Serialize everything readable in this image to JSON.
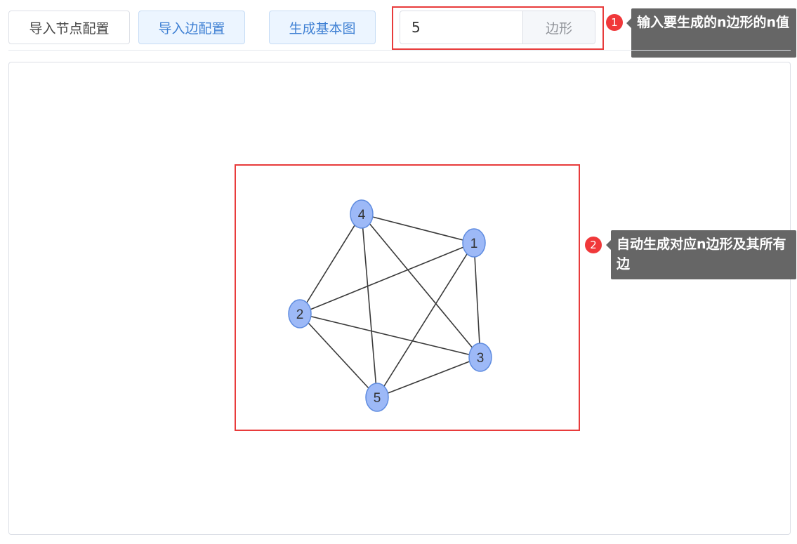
{
  "toolbar": {
    "import_nodes_label": "导入节点配置",
    "import_edges_label": "导入边配置",
    "generate_label": "生成基本图"
  },
  "polygon_input": {
    "value": "5",
    "suffix": "边形"
  },
  "annotations": [
    {
      "badge": "1",
      "text": "输入要生成的n边形的n值"
    },
    {
      "badge": "2",
      "text": "自动生成对应n边形及其所有边"
    }
  ],
  "graph": {
    "node_fill": "#9db9f7",
    "node_stroke": "#5f8ce0",
    "edge_color": "#3a3a3a",
    "nodes": [
      {
        "id": "1",
        "label": "1"
      },
      {
        "id": "2",
        "label": "2"
      },
      {
        "id": "3",
        "label": "3"
      },
      {
        "id": "4",
        "label": "4"
      },
      {
        "id": "5",
        "label": "5"
      }
    ],
    "edges": [
      [
        "1",
        "2"
      ],
      [
        "1",
        "3"
      ],
      [
        "1",
        "4"
      ],
      [
        "1",
        "5"
      ],
      [
        "2",
        "3"
      ],
      [
        "2",
        "4"
      ],
      [
        "2",
        "5"
      ],
      [
        "3",
        "4"
      ],
      [
        "3",
        "5"
      ],
      [
        "4",
        "5"
      ]
    ]
  },
  "colors": {
    "highlight": "#e83b3b",
    "badge": "#f0383a",
    "tooltip_bg": "#666666",
    "primary_text": "#3d7fd3",
    "primary_bg": "#ecf5ff"
  }
}
